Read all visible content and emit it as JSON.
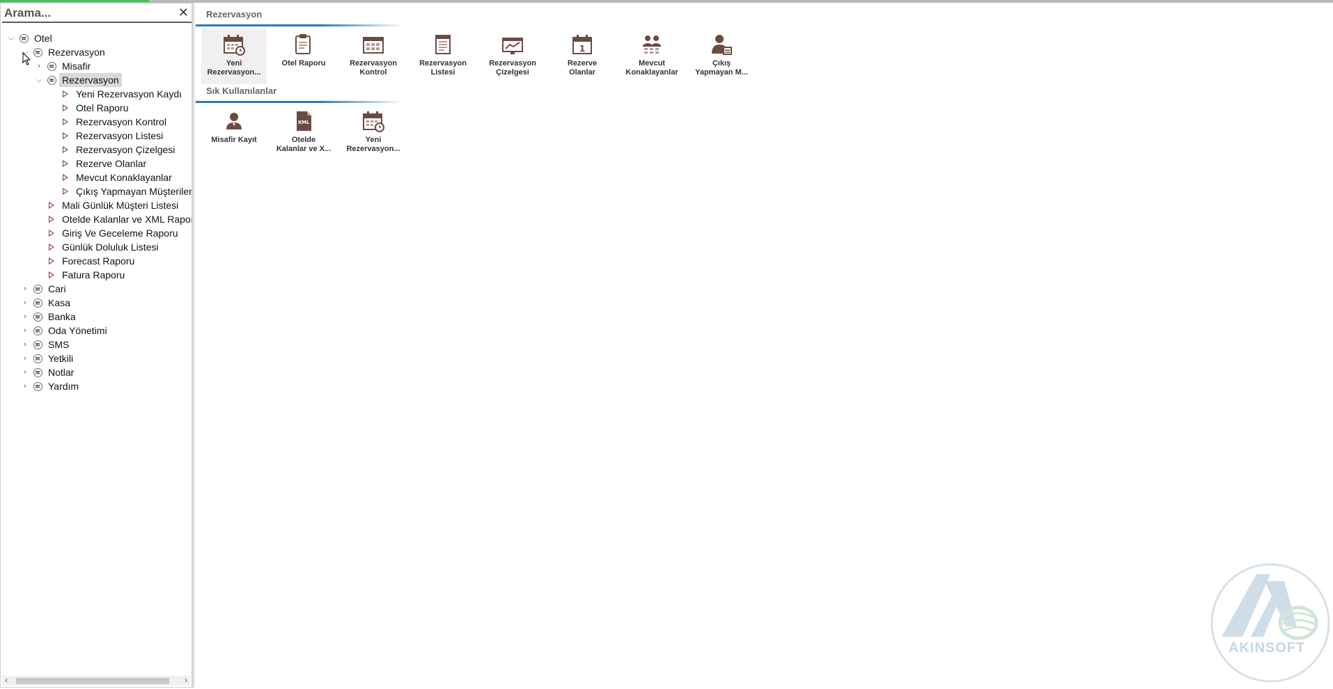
{
  "search": {
    "placeholder": "Arama..."
  },
  "tree": [
    {
      "label": "Otel"
    },
    {
      "label": "Rezervasyon"
    },
    {
      "label": "Misafir"
    },
    {
      "label": "Rezervasyon"
    },
    {
      "label": "Yeni Rezervasyon Kaydı"
    },
    {
      "label": "Otel Raporu"
    },
    {
      "label": "Rezervasyon Kontrol"
    },
    {
      "label": "Rezervasyon Listesi"
    },
    {
      "label": "Rezervasyon Çizelgesi"
    },
    {
      "label": "Rezerve Olanlar"
    },
    {
      "label": "Mevcut Konaklayanlar"
    },
    {
      "label": "Çıkış Yapmayan Müşteriler"
    },
    {
      "label": "Mali Günlük Müşteri Listesi"
    },
    {
      "label": "Otelde Kalanlar ve XML Raporu"
    },
    {
      "label": "Giriş Ve Geceleme Raporu"
    },
    {
      "label": "Günlük Doluluk Listesi"
    },
    {
      "label": "Forecast Raporu"
    },
    {
      "label": "Fatura Raporu"
    },
    {
      "label": "Cari"
    },
    {
      "label": "Kasa"
    },
    {
      "label": "Banka"
    },
    {
      "label": "Oda Yönetimi"
    },
    {
      "label": "SMS"
    },
    {
      "label": "Yetkili"
    },
    {
      "label": "Notlar"
    },
    {
      "label": "Yardım"
    }
  ],
  "main": {
    "section1_title": "Rezervasyon",
    "section2_title": "Sık Kullanılanlar",
    "tiles1": [
      {
        "l1": "Yeni",
        "l2": "Rezervasyon...",
        "icon": "calendar-clock-icon"
      },
      {
        "l1": "Otel Raporu",
        "l2": "",
        "icon": "clipboard-icon"
      },
      {
        "l1": "Rezervasyon",
        "l2": "Kontrol",
        "icon": "grid-calendar-icon"
      },
      {
        "l1": "Rezervasyon",
        "l2": "Listesi",
        "icon": "list-doc-icon"
      },
      {
        "l1": "Rezervasyon",
        "l2": "Çizelgesi",
        "icon": "chart-board-icon"
      },
      {
        "l1": "Rezerve",
        "l2": "Olanlar",
        "icon": "calendar-one-icon"
      },
      {
        "l1": "Mevcut",
        "l2": "Konaklayanlar",
        "icon": "people-group-icon"
      },
      {
        "l1": "Çıkış",
        "l2": "Yapmayan M...",
        "icon": "person-card-icon"
      }
    ],
    "tiles2": [
      {
        "l1": "Misafir Kayıt",
        "l2": "",
        "icon": "person-icon"
      },
      {
        "l1": "Otelde",
        "l2": "Kalanlar ve X...",
        "icon": "xml-file-icon"
      },
      {
        "l1": "Yeni",
        "l2": "Rezervasyon...",
        "icon": "calendar-clock-icon"
      }
    ]
  },
  "brand": {
    "name": "AKINSOFT"
  },
  "colors": {
    "accent": "#2a7ab8",
    "icon": "#6b4a42",
    "progress": "#35c75a"
  }
}
